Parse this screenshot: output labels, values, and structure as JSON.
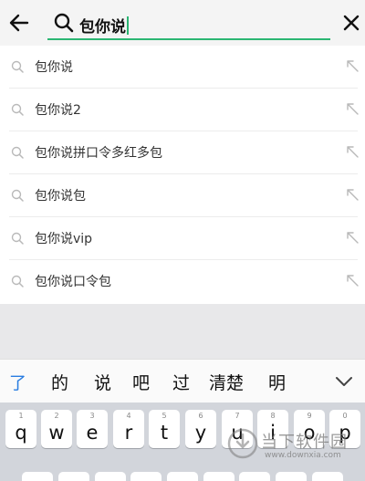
{
  "search": {
    "query": "包你说"
  },
  "icons": {
    "back": "arrow-left-icon",
    "search": "search-icon",
    "clear": "close-icon",
    "suggestion": "search-icon",
    "fill": "arrow-up-left-icon",
    "collapse": "chevron-down-icon"
  },
  "suggestions": [
    {
      "label": "包你说"
    },
    {
      "label": "包你说2"
    },
    {
      "label": "包你说拼口令多红多包"
    },
    {
      "label": "包你说包"
    },
    {
      "label": "包你说vip"
    },
    {
      "label": "包你说口令包"
    }
  ],
  "candidates": [
    "了",
    "的",
    "说",
    "吧",
    "过",
    "清楚",
    "明"
  ],
  "keyboard": {
    "keys": [
      {
        "ch": "q",
        "hint": "1"
      },
      {
        "ch": "w",
        "hint": "2"
      },
      {
        "ch": "e",
        "hint": "3"
      },
      {
        "ch": "r",
        "hint": "4"
      },
      {
        "ch": "t",
        "hint": "5"
      },
      {
        "ch": "y",
        "hint": "6"
      },
      {
        "ch": "u",
        "hint": "7"
      },
      {
        "ch": "i",
        "hint": "8"
      },
      {
        "ch": "o",
        "hint": "9"
      },
      {
        "ch": "p",
        "hint": "0"
      }
    ]
  },
  "watermark": {
    "name": "当下软件园",
    "url": "www.downxia.com"
  },
  "colors": {
    "accent": "#2bb673",
    "candidate_active": "#2a7de1"
  }
}
